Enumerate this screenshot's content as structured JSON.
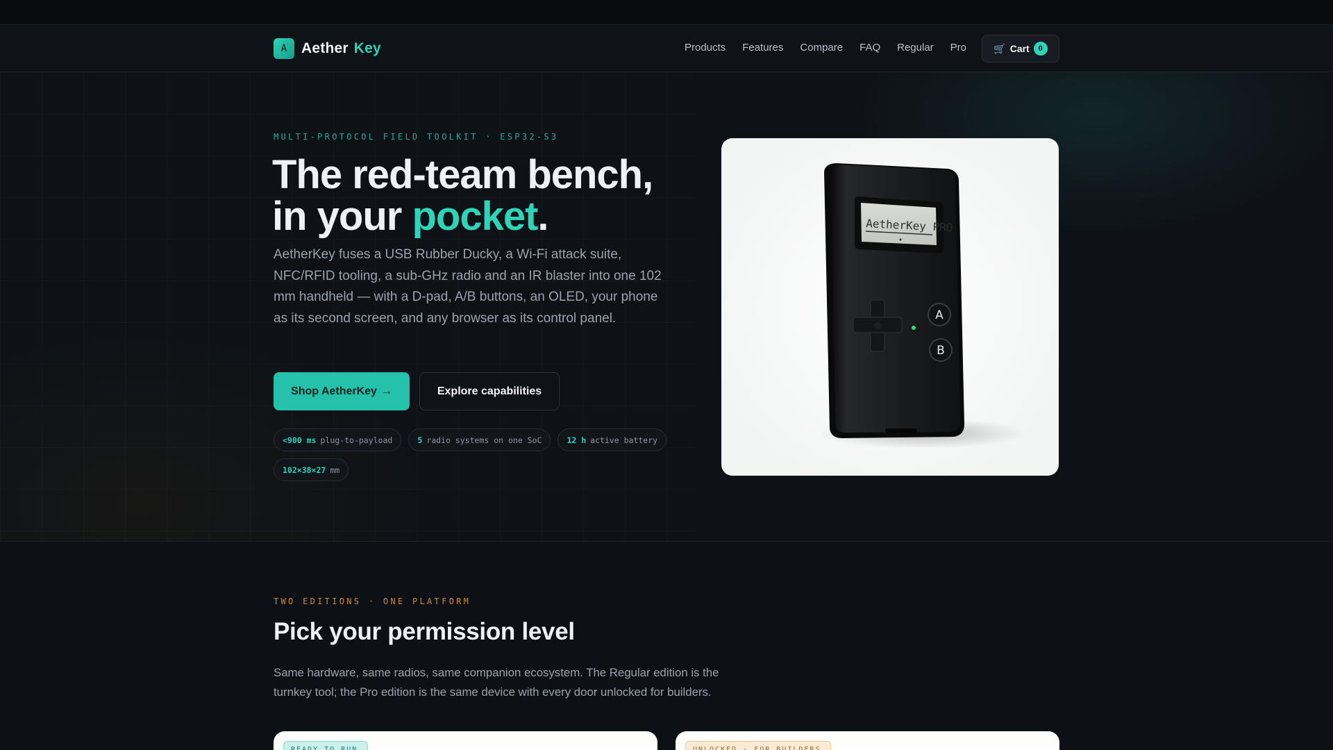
{
  "brand": {
    "logo_letter": "A",
    "name": "Aether",
    "accent": "Key"
  },
  "nav": {
    "links": [
      "Products",
      "Features",
      "Compare",
      "FAQ",
      "Regular",
      "Pro"
    ],
    "cart_label": "Cart",
    "cart_count": "0"
  },
  "hero": {
    "eyebrow": "MULTI-PROTOCOL FIELD TOOLKIT · ESP32-S3",
    "headline_line1": "The red-team bench,",
    "headline_line2_pre": "in your ",
    "headline_accent": "pocket",
    "headline_end": ".",
    "lead": "AetherKey fuses a USB Rubber Ducky, a Wi-Fi attack suite, NFC/RFID tooling, a sub-GHz radio and an IR blaster into one 102 mm handheld — with a D-pad, A/B buttons, an OLED, your phone as its second screen, and any browser as its control panel.",
    "primary_cta": "Shop AetherKey",
    "primary_arrow": "→",
    "secondary_cta": "Explore capabilities",
    "stats": [
      {
        "value": "<900 ms",
        "label": "plug-to-payload"
      },
      {
        "value": "5",
        "label": "radio systems on one SoC"
      },
      {
        "value": "12 h",
        "label": "active battery"
      },
      {
        "value": "102×38×27",
        "label": "mm"
      }
    ],
    "device": {
      "screen_text": "AetherKey PRO",
      "button_a": "A",
      "button_b": "B"
    }
  },
  "editions": {
    "eyebrow": "TWO EDITIONS · ONE PLATFORM",
    "title": "Pick your permission level",
    "lead": "Same hardware, same radios, same companion ecosystem. The Regular edition is the turnkey tool; the Pro edition is the same device with every door unlocked for builders.",
    "regular_tag": "READY TO RUN",
    "pro_tag": "UNLOCKED · FOR BUILDERS"
  },
  "colors": {
    "accent": "#2fd3b8",
    "warm_accent": "#c88a3a",
    "background": "#0d1014"
  }
}
